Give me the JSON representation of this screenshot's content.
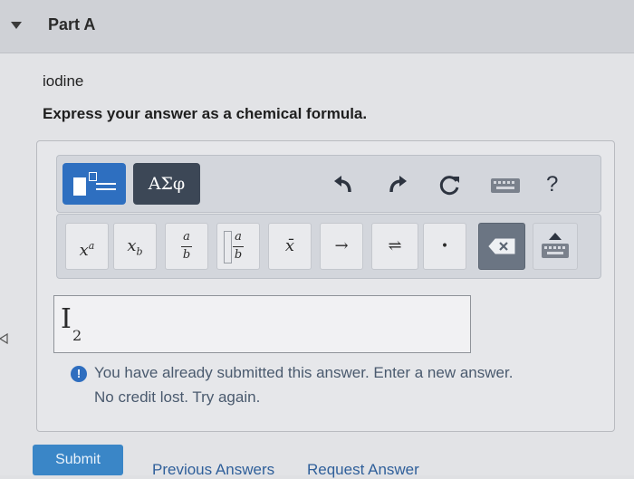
{
  "header": {
    "title": "Part A"
  },
  "question": {
    "element_name": "iodine",
    "instruction": "Express your answer as a chemical formula."
  },
  "toolbar": {
    "greek_label": "ΑΣφ",
    "help_label": "?",
    "template_keys": [
      {
        "name": "superscript",
        "label": "xa"
      },
      {
        "name": "subscript",
        "label": "xb"
      },
      {
        "name": "fraction",
        "top": "a",
        "bottom": "b"
      },
      {
        "name": "mixed-fraction",
        "top": "a",
        "bottom": "b"
      },
      {
        "name": "overbar",
        "label": "x̄"
      },
      {
        "name": "arrow",
        "label": "→"
      },
      {
        "name": "equilibrium",
        "label": "⇌"
      },
      {
        "name": "dot",
        "label": "•"
      }
    ]
  },
  "answer": {
    "main": "I",
    "sub": "2"
  },
  "feedback": {
    "icon": "!",
    "line1": "You have already submitted this answer. Enter a new answer.",
    "line2": "No credit lost. Try again."
  },
  "actions": {
    "submit_label": "Submit",
    "previous_answers_label": "Previous Answers",
    "request_answer_label": "Request Answer"
  },
  "colors": {
    "accent": "#2e6fc0",
    "greek_button": "#3c4756",
    "submit": "#3a86c7"
  }
}
